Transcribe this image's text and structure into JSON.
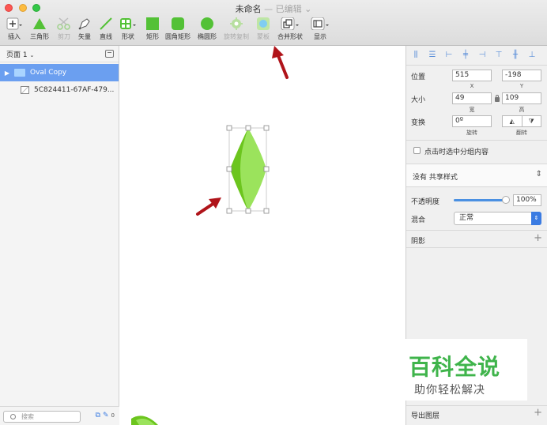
{
  "window": {
    "title": "未命名",
    "title_separator": "—",
    "status": "已编辑"
  },
  "toolbar": {
    "items": [
      {
        "label": "插入",
        "icon": "plus-icon"
      },
      {
        "label": "三角形",
        "icon": "triangle-icon"
      },
      {
        "label": "剪刀",
        "icon": "scissors-icon"
      },
      {
        "label": "矢量",
        "icon": "pen-icon"
      },
      {
        "label": "直线",
        "icon": "line-icon"
      },
      {
        "label": "形状",
        "icon": "shapes-icon"
      },
      {
        "label": "矩形",
        "icon": "rectangle-icon"
      },
      {
        "label": "圆角矩形",
        "icon": "rounded-rectangle-icon"
      },
      {
        "label": "椭圆形",
        "icon": "oval-icon"
      },
      {
        "label": "旋转复制",
        "icon": "rotate-copy-icon"
      },
      {
        "label": "蒙板",
        "icon": "mask-icon"
      },
      {
        "label": "合并形状",
        "icon": "combine-shapes-icon"
      },
      {
        "label": "显示",
        "icon": "view-icon"
      }
    ]
  },
  "sidebar": {
    "page_label": "页面 1",
    "layers": [
      {
        "name": "Oval Copy",
        "type": "group",
        "selected": true
      },
      {
        "name": "5C824411-67AF-479...",
        "type": "image",
        "selected": false
      }
    ],
    "search_placeholder": "搜索",
    "footer_count": "0"
  },
  "inspector": {
    "position_label": "位置",
    "x_value": "515",
    "y_value": "-198",
    "x_label": "X",
    "y_label": "Y",
    "size_label": "大小",
    "width_value": "49",
    "height_value": "109",
    "width_label": "宽",
    "height_label": "高",
    "transform_label": "变换",
    "rotation_value": "0º",
    "rotation_label": "旋转",
    "flip_label": "翻转",
    "group_click_label": "点击时选中分组内容",
    "shared_style": "没有 共享样式",
    "opacity_label": "不透明度",
    "opacity_value": "100%",
    "opacity_level": 1.0,
    "blend_label": "混合",
    "blend_value": "正常",
    "shadow_label": "阴影",
    "export_label": "导出图层"
  },
  "watermark": {
    "big": "百科全说",
    "small": "助你轻松解决"
  },
  "colors": {
    "accent": "#3a7be2",
    "selection": "#6b9ff0",
    "shape_dark": "#6cc51e",
    "shape_light": "#9be35c",
    "arrow": "#b0141a",
    "watermark_green": "#3fb44b"
  }
}
